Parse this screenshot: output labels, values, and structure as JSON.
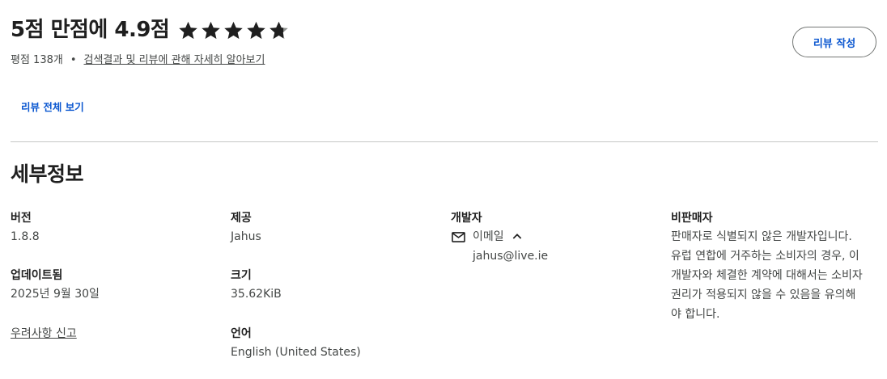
{
  "ratings": {
    "title": "5점 만점에 4.9점",
    "star_count": 5,
    "rating_value": 4.9,
    "count_text": "평점 138개",
    "separator": "•",
    "learn_link": "검색결과 및 리뷰에 관해 자세히 알아보기",
    "write_review": "리뷰 작성",
    "see_all": "리뷰 전체 보기"
  },
  "details": {
    "title": "세부정보",
    "version": {
      "label": "버전",
      "value": "1.8.8"
    },
    "updated": {
      "label": "업데이트됨",
      "value": "2025년 9월 30일"
    },
    "report": "우려사항 신고",
    "offered_by": {
      "label": "제공",
      "value": "Jahus"
    },
    "size": {
      "label": "크기",
      "value": "35.62KiB"
    },
    "language": {
      "label": "언어",
      "value": "English (United States)"
    },
    "developer": {
      "label": "개발자",
      "email_label": "이메일",
      "email": "jahus@live.ie"
    },
    "non_trader": {
      "label": "비판매자",
      "text": "판매자로 식별되지 않은 개발자입니다. 유럽 연합에 거주하는 소비자의 경우, 이 개발자와 체결한 계약에 대해서는 소비자 권리가 적용되지 않을 수 있음을 유의해야 합니다."
    }
  },
  "colors": {
    "accent": "#0b57d0",
    "text": "#1f1f1f",
    "muted": "#444746",
    "divider": "#c4c7c5"
  }
}
